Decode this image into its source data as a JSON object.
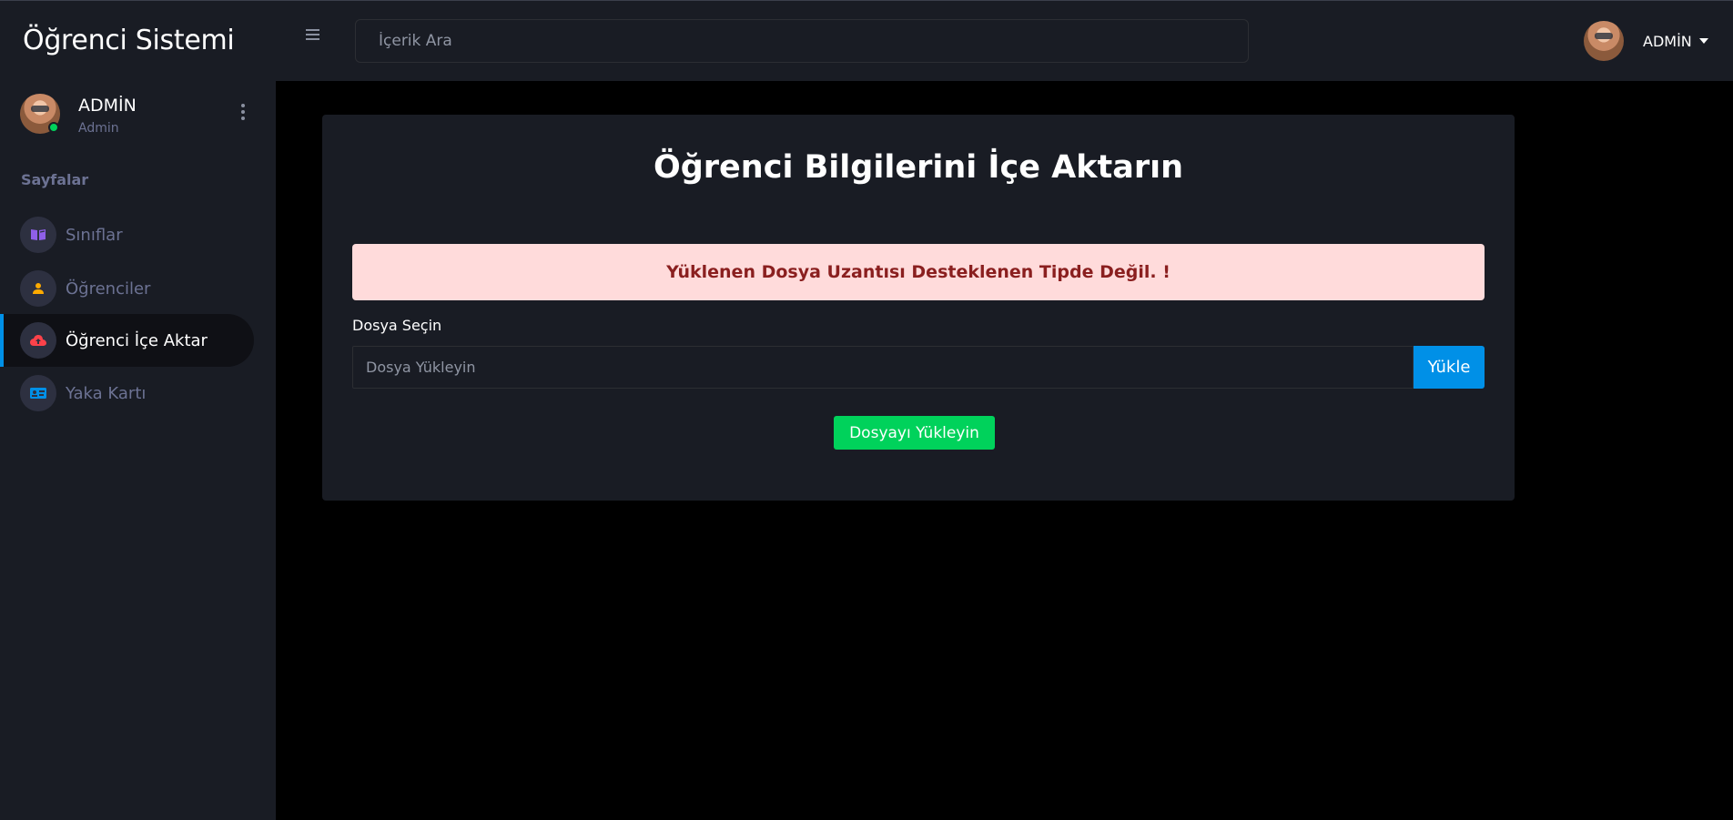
{
  "navbar": {
    "brand": "Öğrenci Sistemi",
    "search_placeholder": "İçerik Ara",
    "user_name": "ADMİN"
  },
  "sidebar": {
    "profile": {
      "name": "ADMİN",
      "role": "Admin"
    },
    "section_title": "Sayfalar",
    "items": [
      {
        "label": "Sınıflar",
        "icon": "book-icon",
        "color": "#8f5fe8"
      },
      {
        "label": "Öğrenciler",
        "icon": "user-icon",
        "color": "#ffab00"
      },
      {
        "label": "Öğrenci İçe Aktar",
        "icon": "cloud-upload-icon",
        "color": "#fc424a",
        "active": true
      },
      {
        "label": "Yaka Kartı",
        "icon": "id-card-icon",
        "color": "#0090e7"
      }
    ]
  },
  "main": {
    "title": "Öğrenci Bilgilerini İçe Aktarın",
    "alert": "Yüklenen Dosya Uzantısı Desteklenen Tipde Değil. !",
    "file_label": "Dosya Seçin",
    "file_placeholder": "Dosya Yükleyin",
    "upload_button": "Yükle",
    "submit_button": "Dosyayı Yükleyin"
  },
  "colors": {
    "background": "#000000",
    "panel": "#191c24",
    "accent_blue": "#0090e7",
    "success_green": "#00d25b",
    "alert_bg": "#ffdbdb",
    "alert_text": "#8a1f1f"
  }
}
